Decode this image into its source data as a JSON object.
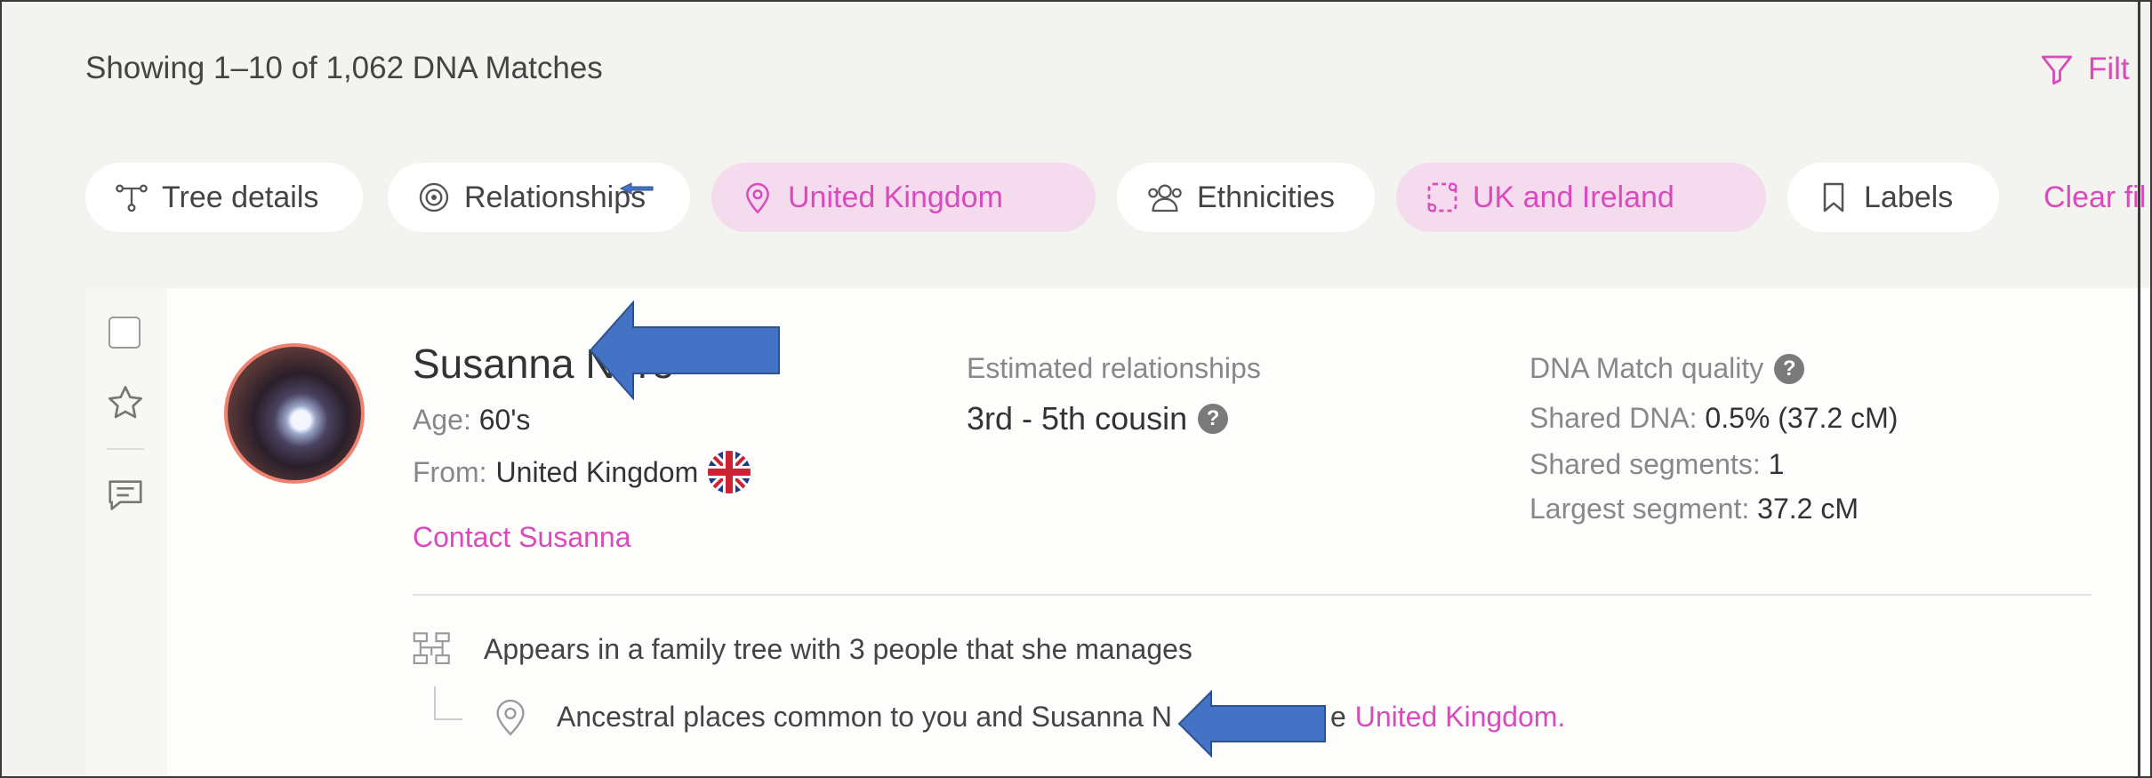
{
  "header": {
    "showing_text": "Showing 1–10 of 1,062 DNA Matches",
    "filter_label": "Filt"
  },
  "chips": [
    {
      "label": "Tree details",
      "icon": "tree-icon",
      "active": false
    },
    {
      "label": "Relationships",
      "icon": "target-icon",
      "active": false
    },
    {
      "label": "United Kingdom",
      "icon": "location-pin-icon",
      "active": true
    },
    {
      "label": "Ethnicities",
      "icon": "people-icon",
      "active": false
    },
    {
      "label": "UK and Ireland",
      "icon": "region-icon",
      "active": true
    },
    {
      "label": "Labels",
      "icon": "bookmark-icon",
      "active": false
    }
  ],
  "clear_filters_label": "Clear fil",
  "match": {
    "name": "Susanna Nore",
    "age_label": "Age:",
    "age_value": "60's",
    "from_label": "From:",
    "from_value": "United Kingdom",
    "contact_label": "Contact Susanna",
    "estimated_label": "Estimated relationships",
    "estimated_value": "3rd - 5th cousin",
    "quality_label": "DNA Match quality",
    "shared_dna_label": "Shared DNA:",
    "shared_dna_value": "0.5% (37.2 cM)",
    "shared_segments_label": "Shared segments:",
    "shared_segments_value": "1",
    "largest_segment_label": "Largest segment:",
    "largest_segment_value": "37.2 cM",
    "tree_text": "Appears in a family tree with 3 people that she manages",
    "ancestral_text_prefix": "Ancestral places common to you and Susanna N",
    "ancestral_text_middle": "e",
    "ancestral_link": "United Kingdom."
  },
  "colors": {
    "accent": "#d94bbd",
    "chip_active_bg": "#f5dbee",
    "annotation_arrow": "#4472c4"
  }
}
